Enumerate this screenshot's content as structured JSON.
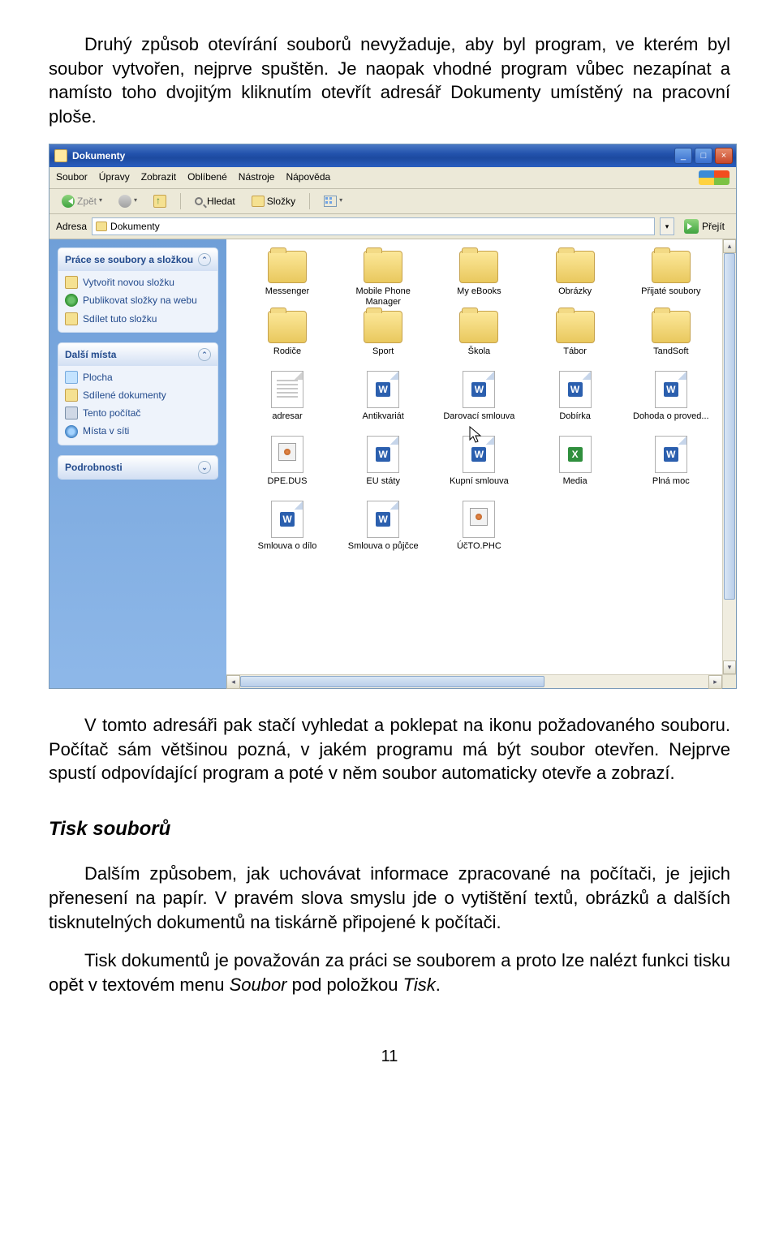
{
  "para1": "Druhý způsob otevírání souborů nevyžaduje, aby byl program, ve kterém byl soubor vytvořen, nejprve spuštěn. Je naopak vhodné program vůbec nezapínat a namísto toho dvojitým kliknutím otevřít adresář Dokumenty umístěný na pracovní ploše.",
  "para2": "V tomto adresáři pak stačí vyhledat a poklepat na ikonu požadovaného souboru. Počítač sám většinou pozná, v jakém programu má být soubor otevřen. Nejprve spustí odpovídající program a poté v něm soubor automaticky otevře a zobrazí.",
  "heading": "Tisk souborů",
  "para3": "Dalším způsobem, jak uchovávat informace zpracované na počítači, je jejich přenesení na papír. V pravém slova smyslu jde o vytištění textů, obrázků a dalších tisknutelných dokumentů na tiskárně připojené k počítači.",
  "para4_a": "Tisk dokumentů je považován za práci se souborem a proto lze nalézt funkci tisku opět v textovém menu ",
  "para4_b": "Soubor",
  "para4_c": " pod položkou ",
  "para4_d": "Tisk",
  "para4_e": ".",
  "page_number": "11",
  "win": {
    "title": "Dokumenty",
    "menu": [
      "Soubor",
      "Úpravy",
      "Zobrazit",
      "Oblíbené",
      "Nástroje",
      "Nápověda"
    ],
    "toolbar": {
      "back": "Zpět",
      "search": "Hledat",
      "folders": "Složky"
    },
    "addr_label": "Adresa",
    "addr_value": "Dokumenty",
    "go": "Přejít",
    "panels": {
      "tasks": {
        "title": "Práce se soubory a složkou",
        "items": [
          "Vytvořit novou složku",
          "Publikovat složky na webu",
          "Sdílet tuto složku"
        ]
      },
      "places": {
        "title": "Další místa",
        "items": [
          "Plocha",
          "Sdílené dokumenty",
          "Tento počítač",
          "Místa v síti"
        ]
      },
      "details": {
        "title": "Podrobnosti"
      }
    },
    "files": {
      "row1": [
        {
          "type": "folder",
          "label": "Messenger"
        },
        {
          "type": "folder",
          "label": "Mobile Phone Manager"
        },
        {
          "type": "folder",
          "label": "My eBooks"
        },
        {
          "type": "folder",
          "label": "Obrázky"
        },
        {
          "type": "folder",
          "label": "Přijaté soubory"
        }
      ],
      "row2": [
        {
          "type": "folder",
          "label": "Rodiče"
        },
        {
          "type": "folder",
          "label": "Sport"
        },
        {
          "type": "folder",
          "label": "Škola"
        },
        {
          "type": "folder",
          "label": "Tábor"
        },
        {
          "type": "folder",
          "label": "TandSoft"
        }
      ],
      "row3": [
        {
          "type": "txt",
          "label": "adresar"
        },
        {
          "type": "word",
          "label": "Antikvariát"
        },
        {
          "type": "word",
          "label": "Darovací smlouva"
        },
        {
          "type": "word",
          "label": "Dobírka"
        },
        {
          "type": "word",
          "label": "Dohoda o proved..."
        }
      ],
      "row4": [
        {
          "type": "generic",
          "label": "DPE.DUS"
        },
        {
          "type": "word",
          "label": "EU státy"
        },
        {
          "type": "word",
          "label": "Kupní smlouva"
        },
        {
          "type": "excel",
          "label": "Media"
        },
        {
          "type": "word",
          "label": "Plná moc"
        }
      ],
      "row5": [
        {
          "type": "word",
          "label": "Smlouva o dílo"
        },
        {
          "type": "word",
          "label": "Smlouva o půjčce"
        },
        {
          "type": "generic",
          "label": "ÚčTO.PHC"
        }
      ]
    }
  }
}
